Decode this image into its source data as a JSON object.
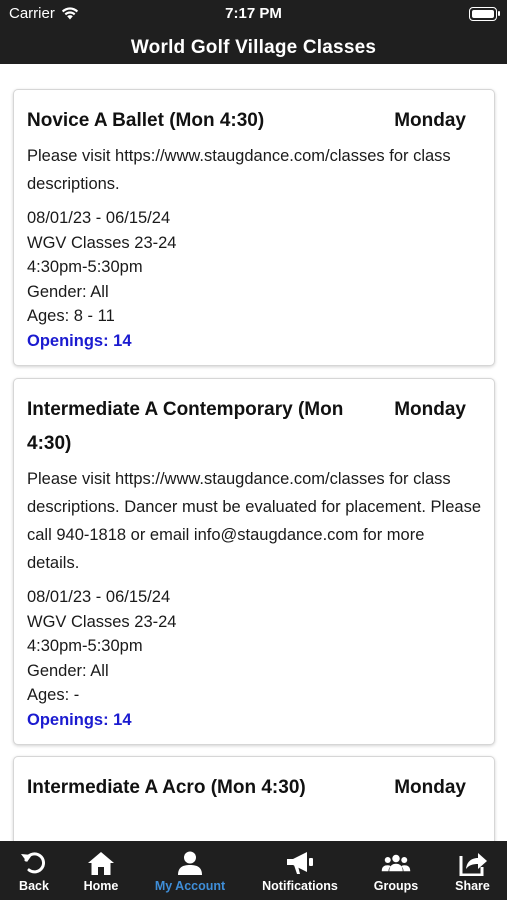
{
  "status_bar": {
    "carrier": "Carrier",
    "time": "7:17 PM"
  },
  "header": {
    "title": "World Golf Village Classes"
  },
  "classes": [
    {
      "title": "Novice A Ballet (Mon 4:30)",
      "day": "Monday",
      "description": "Please visit https://www.staugdance.com/classes for class descriptions.",
      "dates": "08/01/23 - 06/15/24",
      "session": "WGV Classes 23-24",
      "time": "4:30pm-5:30pm",
      "gender": "Gender: All",
      "ages": "Ages: 8 - 11",
      "openings": "Openings: 14"
    },
    {
      "title": "Intermediate A Contemporary (Mon 4:30)",
      "day": "Monday",
      "description": "Please visit https://www.staugdance.com/classes for class descriptions. Dancer must be evaluated for placement. Please call 940-1818 or email info@staugdance.com for more details.",
      "dates": "08/01/23 - 06/15/24",
      "session": "WGV Classes 23-24",
      "time": "4:30pm-5:30pm",
      "gender": "Gender: All",
      "ages": "Ages: -",
      "openings": "Openings: 14"
    },
    {
      "title": "Intermediate A Acro (Mon 4:30)",
      "day": "Monday"
    }
  ],
  "tab_bar": {
    "back": "Back",
    "home": "Home",
    "my_account": "My Account",
    "notifications": "Notifications",
    "groups": "Groups",
    "share": "Share",
    "active_color": "#3f8ed8"
  }
}
